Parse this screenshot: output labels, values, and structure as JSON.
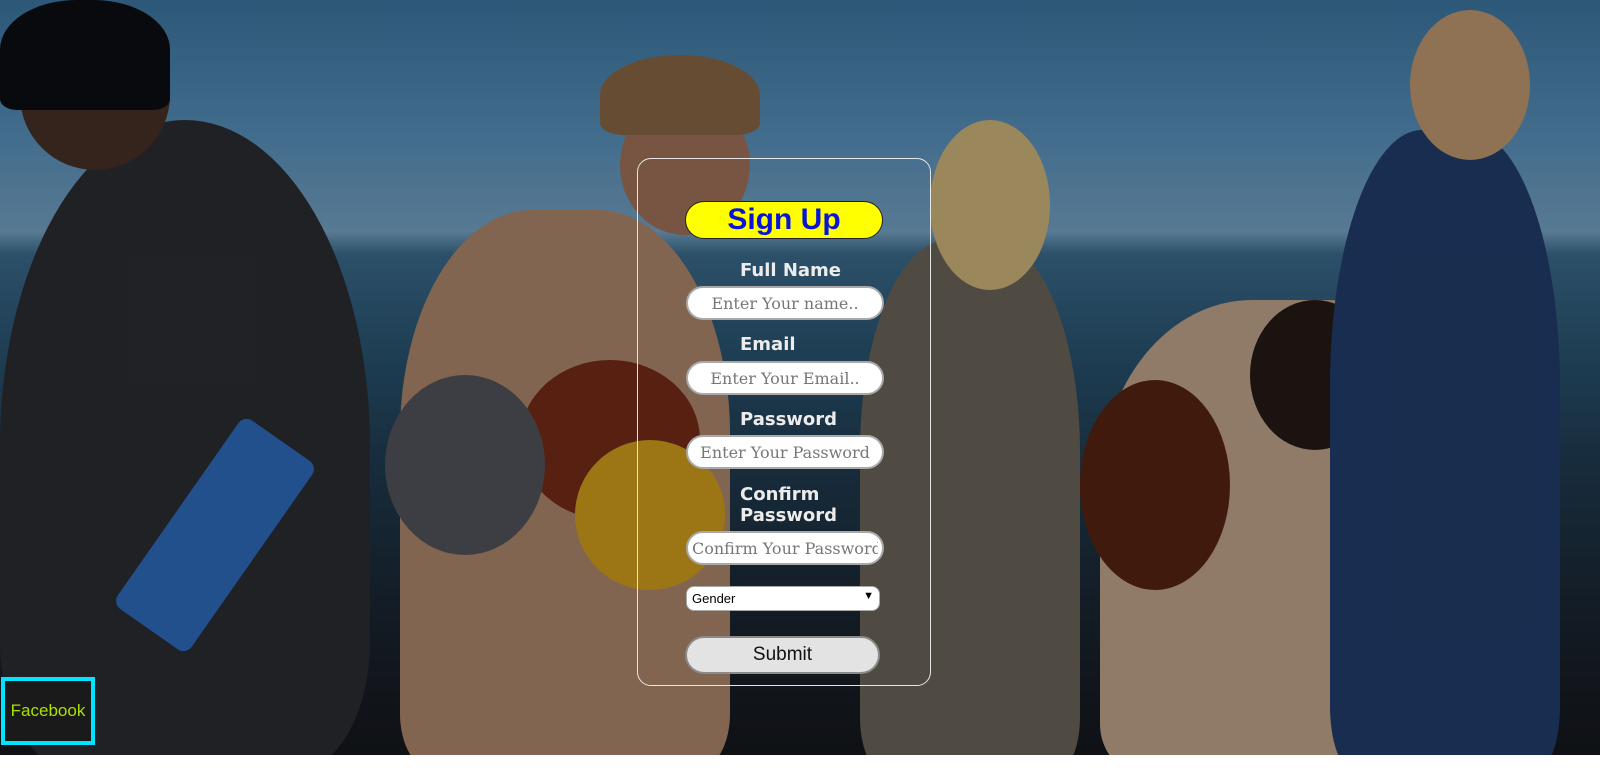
{
  "form": {
    "title": "Sign Up",
    "fields": {
      "name": {
        "label": "Full Name",
        "placeholder": "Enter Your name.."
      },
      "email": {
        "label": "Email",
        "placeholder": "Enter Your Email.."
      },
      "password": {
        "label": "Password",
        "placeholder": "Enter Your Password"
      },
      "confirm": {
        "label_line1": "Confirm",
        "label_line2": "Password",
        "placeholder": "Confirm Your Password.."
      }
    },
    "gender": {
      "selected": "Gender",
      "arrow_icon": "triangle-down"
    },
    "submit_label": "Submit"
  },
  "social": {
    "facebook_label": "Facebook"
  },
  "colors": {
    "title_bg": "#ffff00",
    "title_text": "#0a14d6",
    "facebook_border": "#00e5ff",
    "facebook_text": "#a7e300"
  }
}
